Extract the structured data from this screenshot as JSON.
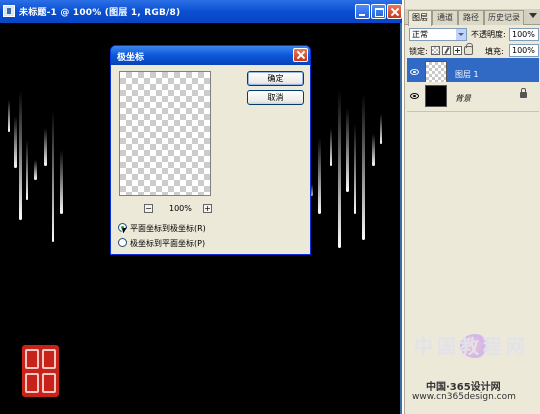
{
  "document": {
    "title": "未标题-1 @ 100% (图层 1, RGB/8)"
  },
  "panel": {
    "tabs": [
      "图层",
      "通道",
      "路径",
      "历史记录"
    ],
    "blend_mode": "正常",
    "opacity_label": "不透明度:",
    "opacity_value": "100%",
    "lock_label": "锁定:",
    "fill_label": "填充:",
    "fill_value": "100%",
    "layers": [
      {
        "name": "图层 1",
        "selected": true
      },
      {
        "name": "背景",
        "selected": false,
        "locked": true
      }
    ]
  },
  "dialog": {
    "title": "极坐标",
    "ok_label": "确定",
    "cancel_label": "取消",
    "zoom_out": "−",
    "zoom_in": "+",
    "zoom_level": "100%",
    "options": [
      {
        "label": "平面坐标到极坐标(R)",
        "checked": true
      },
      {
        "label": "极坐标到平面坐标(P)",
        "checked": false
      }
    ]
  },
  "watermark": {
    "big": "中国教程网",
    "sub": "中国·365设计网",
    "url": "www.cn365design.com"
  },
  "colors": {
    "titlebar_blue": "#0a4fd0",
    "selection_blue": "#316ac5",
    "dialog_bg": "#ece9d8",
    "canvas": "#000000",
    "seal_red": "#c8231b"
  }
}
